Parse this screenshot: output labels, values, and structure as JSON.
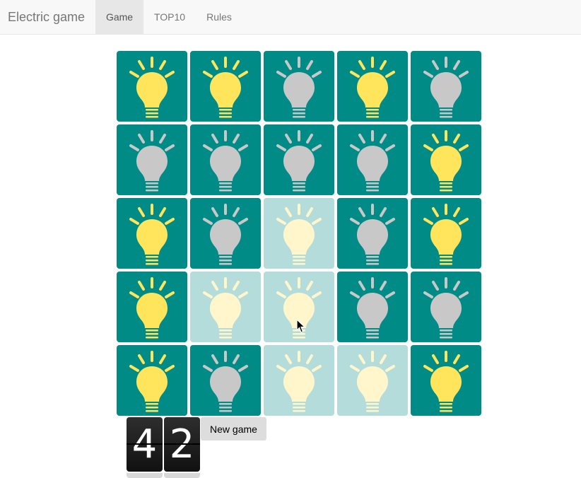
{
  "navbar": {
    "brand": "Electric game",
    "tabs": [
      {
        "label": "Game",
        "active": true
      },
      {
        "label": "TOP10",
        "active": false
      },
      {
        "label": "Rules",
        "active": false
      }
    ]
  },
  "board": {
    "rows": [
      [
        "on",
        "on",
        "off",
        "on",
        "off"
      ],
      [
        "off",
        "off",
        "off",
        "off",
        "on"
      ],
      [
        "on",
        "off",
        "faded",
        "off",
        "on"
      ],
      [
        "on",
        "faded",
        "faded",
        "off",
        "off"
      ],
      [
        "on",
        "off",
        "faded",
        "faded",
        "on"
      ]
    ],
    "colors": {
      "tile": "#008b87",
      "tile_faded": "#b3dcdb",
      "bulb_on": "#ffe55c",
      "bulb_off": "#c8c8c8",
      "bulb_faded": "#fff6cc"
    }
  },
  "counter": {
    "digits": [
      "4",
      "2"
    ]
  },
  "controls": {
    "new_game_label": "New game"
  }
}
